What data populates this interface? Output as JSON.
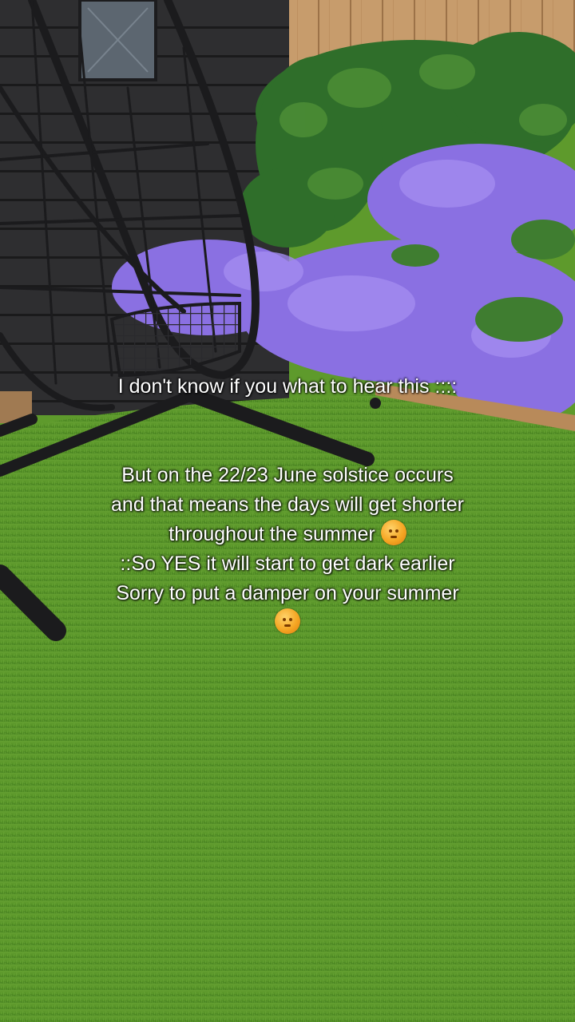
{
  "caption": {
    "line1": "I don't know if you what to hear this ::::",
    "line2": "But on the 22/23 June solstice occurs",
    "line3": "and that means the days will get shorter",
    "line4": "throughout the summer",
    "line5": "::So YES it will start to get dark earlier",
    "line6": "Sorry to put a damper on your summer",
    "emoji_icon": "sun-face-icon"
  },
  "colors": {
    "grass": "#5e9a2c",
    "flowers": "#8a6fe0",
    "fence": "#c59a6a",
    "shed": "#2b2b2b",
    "chair": "#1f1f22"
  }
}
